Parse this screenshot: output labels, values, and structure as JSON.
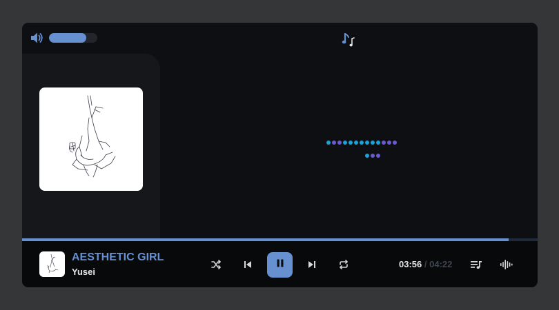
{
  "player": {
    "volume_level": 0.77,
    "progress_fraction": 0.944
  },
  "track": {
    "title": "AESTHETIC GIRL",
    "artist": "Yusei",
    "current_time": "03:56",
    "separator": "/",
    "total_time": "04:22"
  },
  "icons": {
    "volume": "volume-high-icon",
    "music": "music-notes-icon",
    "shuffle": "shuffle-icon",
    "previous": "skip-previous-icon",
    "play_pause": "pause-icon",
    "next": "skip-next-icon",
    "repeat": "repeat-icon",
    "playlist": "playlist-icon",
    "visualizer": "audio-waveform-icon"
  },
  "colors": {
    "accent": "#6690d0",
    "background": "#0d0f12",
    "side_panel": "#15171b",
    "bottom_bar": "#08090b",
    "loader_blue": "#1aa3d9",
    "loader_purple": "#6a5acd"
  }
}
